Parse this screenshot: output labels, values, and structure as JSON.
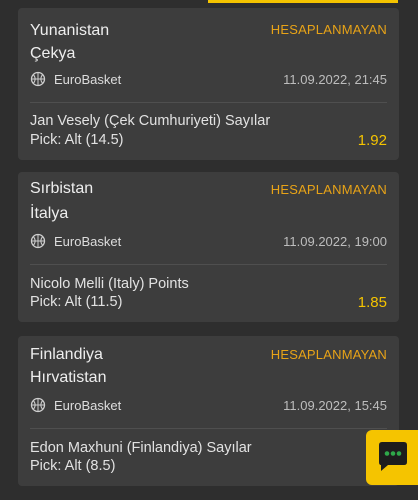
{
  "colors": {
    "accent": "#f5c400",
    "status": "#e8a317",
    "card": "#3d3d3d",
    "background": "#2e2e2e"
  },
  "bets": [
    {
      "home_team": "Yunanistan",
      "away_team": "Çekya",
      "status": "HESAPLANMAYAN",
      "league": "EuroBasket",
      "league_icon": "basketball-icon",
      "datetime": "11.09.2022, 21:45",
      "market": "Jan Vesely (Çek Cumhuriyeti) Sayılar",
      "pick": "Pick:  Alt (14.5)",
      "odds": "1.92"
    },
    {
      "home_team": "Sırbistan",
      "away_team": "İtalya",
      "status": "HESAPLANMAYAN",
      "league": "EuroBasket",
      "league_icon": "basketball-icon",
      "datetime": "11.09.2022, 19:00",
      "market": "Nicolo Melli (Italy) Points",
      "pick": "Pick:  Alt (11.5)",
      "odds": "1.85"
    },
    {
      "home_team": "Finlandiya",
      "away_team": "Hırvatistan",
      "status": "HESAPLANMAYAN",
      "league": "EuroBasket",
      "league_icon": "basketball-icon",
      "datetime": "11.09.2022, 15:45",
      "market": "Edon Maxhuni (Finlandiya) Sayılar",
      "pick": "Pick:  Alt (8.5)",
      "odds": ""
    }
  ],
  "chat_button": {
    "icon": "chat-bubble-icon"
  }
}
